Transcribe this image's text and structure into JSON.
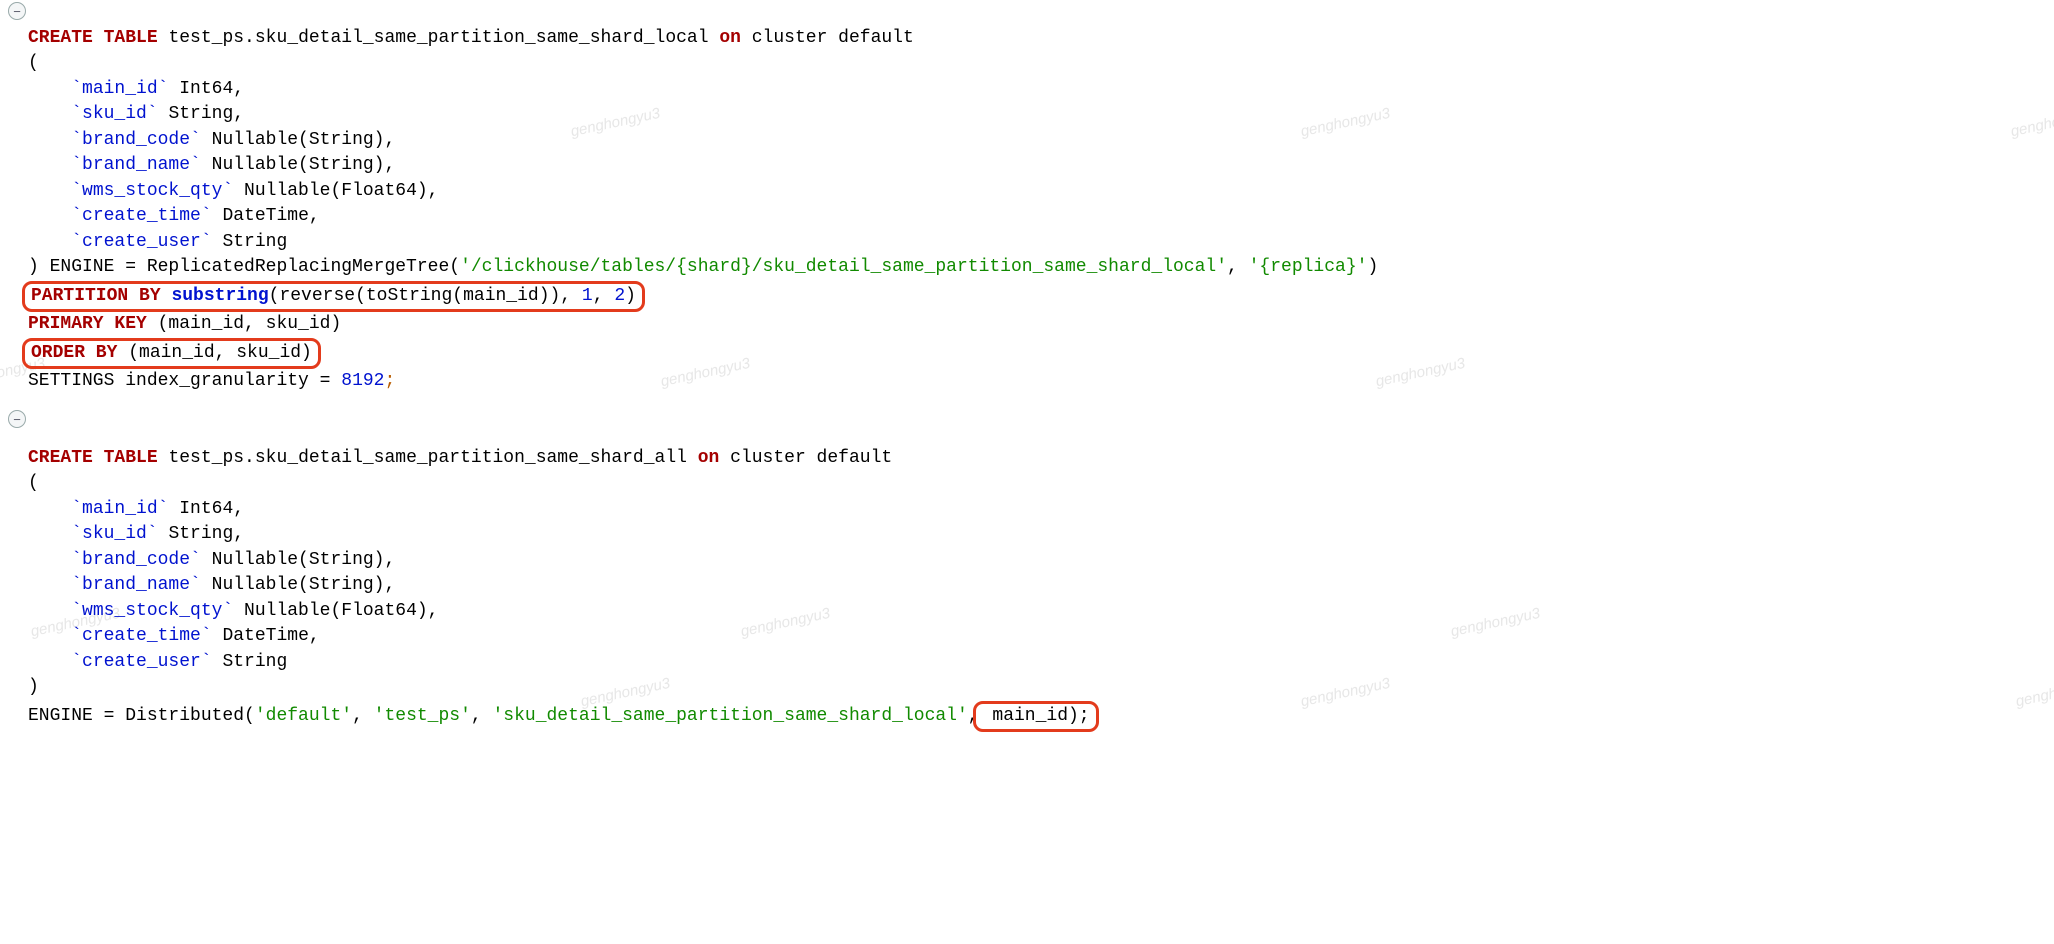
{
  "fold_glyph": "−",
  "watermark_text": "genghongyu3",
  "block1": {
    "l1_create": "CREATE",
    "l1_table": "TABLE",
    "l1_name": " test_ps.sku_detail_same_partition_same_shard_local ",
    "l1_on": "on",
    "l1_cluster": " cluster default",
    "l2": "(",
    "l3_c": "`main_id`",
    "l3_t": " Int64,",
    "l4_c": "`sku_id`",
    "l4_t": " String,",
    "l5_c": "`brand_code`",
    "l5_t": " Nullable(String),",
    "l6_c": "`brand_name`",
    "l6_t": " Nullable(String),",
    "l7_c": "`wms_stock_qty`",
    "l7_t": " Nullable(Float64),",
    "l8_c": "`create_time`",
    "l8_t": " DateTime,",
    "l9_c": "`create_user`",
    "l9_t": " String",
    "l10_a": ") ENGINE = ReplicatedReplacingMergeTree(",
    "l10_s1": "'/clickhouse/tables/{shard}/sku_detail_same_partition_same_shard_local'",
    "l10_m": ", ",
    "l10_s2": "'{replica}'",
    "l10_e": ")",
    "l11_kw": "PARTITION BY",
    "l11_func": "substring",
    "l11_a": "(reverse(toString(main_id)), ",
    "l11_n1": "1",
    "l11_m": ", ",
    "l11_n2": "2",
    "l11_e": ")",
    "l12_kw": "PRIMARY KEY",
    "l12_r": " (main_id, sku_id)",
    "l13_kw": "ORDER BY",
    "l13_r": " (main_id, sku_id)",
    "l14_a": "SETTINGS index_granularity = ",
    "l14_n": "8192",
    "l14_s": ";"
  },
  "block2": {
    "l1_create": "CREATE",
    "l1_table": "TABLE",
    "l1_name": " test_ps.sku_detail_same_partition_same_shard_all ",
    "l1_on": "on",
    "l1_cluster": " cluster default",
    "l2": "(",
    "l3_c": "`main_id`",
    "l3_t": " Int64,",
    "l4_c": "`sku_id`",
    "l4_t": " String,",
    "l5_c": "`brand_code`",
    "l5_t": " Nullable(String),",
    "l6_c": "`brand_name`",
    "l6_t": " Nullable(String),",
    "l7_c": "`wms_stock_qty`",
    "l7_t": " Nullable(Float64),",
    "l8_c": "`create_time`",
    "l8_t": " DateTime,",
    "l9_c": "`create_user`",
    "l9_t": " String",
    "l10": ")",
    "l11_a": "ENGINE = Distributed(",
    "l11_s1": "'default'",
    "l11_m1": ", ",
    "l11_s2": "'test_ps'",
    "l11_m2": ", ",
    "l11_s3": "'sku_detail_same_partition_same_shard_local'",
    "l11_m3": ",",
    "l11_box": " main_id);"
  }
}
